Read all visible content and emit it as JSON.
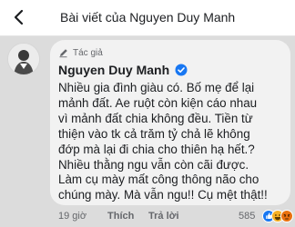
{
  "header": {
    "title": "Bài viết của Nguyen Duy Manh"
  },
  "comment": {
    "badge": "Tác giả",
    "author": "Nguyen Duy Manh",
    "lines": [
      "Nhiều gia đình giàu có. Bố mẹ để lại",
      "mảnh đất. Ae ruột còn kiện cáo nhau",
      "vì mảnh đất chia không đều. Tiền từ",
      "thiện vào tk cả trăm tỷ chả lẽ không",
      "đớp mà lại đi chia cho thiên hạ hết.?",
      "Nhiều thằng ngu vẫn còn cãi được.",
      "Làm cụ mày mất công thông não cho",
      "chúng mày. Mà vẫn ngu!! Cụ mệt thật!!"
    ]
  },
  "actions": {
    "timestamp": "19 giờ",
    "like_label": "Thích",
    "reply_label": "Trả lời",
    "reaction_count": "585"
  },
  "icons": {
    "back": "arrow-left-icon",
    "badge": "pencil-icon",
    "verified": "verified-check-icon",
    "reactions": [
      "like-icon",
      "haha-icon",
      "angry-icon"
    ]
  },
  "colors": {
    "verified": "#1877f2",
    "like": "#1877f2",
    "haha": "#f7b125",
    "angry": "#e9710f",
    "bubble": "#f2f2f2"
  }
}
